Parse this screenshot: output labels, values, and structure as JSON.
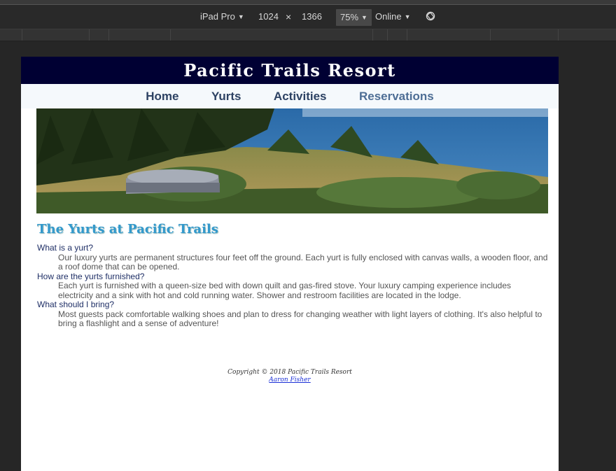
{
  "devtools": {
    "device": "iPad Pro",
    "width": "1024",
    "times": "×",
    "height": "1366",
    "zoom": "75%",
    "network": "Online"
  },
  "site": {
    "title": "Pacific Trails Resort",
    "nav": [
      "Home",
      "Yurts",
      "Activities",
      "Reservations"
    ],
    "heading": "The Yurts at Pacific Trails",
    "faq": [
      {
        "q": "What is a yurt?",
        "a": "Our luxury yurts are permanent structures four feet off the ground. Each yurt is fully enclosed with canvas walls, a wooden floor, and a roof dome that can be opened."
      },
      {
        "q": "How are the yurts furnished?",
        "a": "Each yurt is furnished with a queen-size bed with down quilt and gas-fired stove. Your luxury camping experience includes electricity and a sink with hot and cold running water. Shower and restroom facilities are located in the lodge."
      },
      {
        "q": "What should I bring?",
        "a": "Most guests pack comfortable walking shoes and plan to dress for changing weather with light layers of clothing. It's also helpful to bring a flashlight and a sense of adventure!"
      }
    ],
    "footer": {
      "copyright": "Copyright © 2018 Pacific Trails Resort",
      "author": "Aaron Fisher"
    }
  }
}
